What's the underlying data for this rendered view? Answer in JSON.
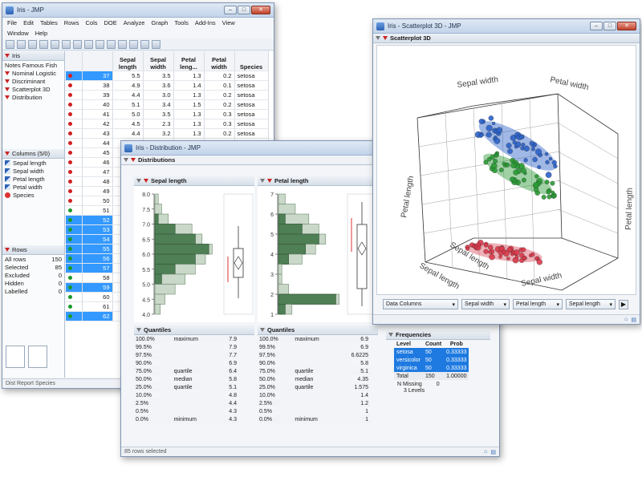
{
  "iris_window": {
    "title": "Iris - JMP",
    "menu": [
      "File",
      "Edit",
      "Tables",
      "Rows",
      "Cols",
      "DOE",
      "Analyze",
      "Graph",
      "Tools",
      "Add-Ins",
      "View"
    ],
    "menu2": [
      "Window",
      "Help"
    ],
    "table_panel": {
      "name": "Iris",
      "notes": "Notes",
      "notes_value": "Famous Fish",
      "scripts": [
        "Nominal Logistic",
        "Discriminant",
        "Scatterplot 3D",
        "Distribution"
      ]
    },
    "columns_panel": {
      "header": "Columns (5/0)",
      "columns": [
        "Sepal length",
        "Sepal width",
        "Petal length",
        "Petal width",
        "Species"
      ]
    },
    "rows_panel": {
      "header": "Rows",
      "items": [
        {
          "label": "All rows",
          "value": "150"
        },
        {
          "label": "Selected",
          "value": "85"
        },
        {
          "label": "Excluded",
          "value": "0"
        },
        {
          "label": "Hidden",
          "value": "0"
        },
        {
          "label": "Labelled",
          "value": "0"
        }
      ]
    },
    "col_headers": [
      "Sepal length",
      "Sepal width",
      "Petal leng...",
      "Petal width",
      "Species"
    ],
    "rows": [
      {
        "n": "37",
        "sl": "5.5",
        "sw": "3.5",
        "pl": "1.3",
        "pw": "0.2",
        "sp": "setosa",
        "sel": true,
        "color": "#d02020"
      },
      {
        "n": "38",
        "sl": "4.9",
        "sw": "3.6",
        "pl": "1.4",
        "pw": "0.1",
        "sp": "setosa",
        "sel": false,
        "color": "#d02020"
      },
      {
        "n": "39",
        "sl": "4.4",
        "sw": "3.0",
        "pl": "1.3",
        "pw": "0.2",
        "sp": "setosa",
        "sel": false,
        "color": "#d02020"
      },
      {
        "n": "40",
        "sl": "5.1",
        "sw": "3.4",
        "pl": "1.5",
        "pw": "0.2",
        "sp": "setosa",
        "sel": false,
        "color": "#d02020"
      },
      {
        "n": "41",
        "sl": "5.0",
        "sw": "3.5",
        "pl": "1.3",
        "pw": "0.3",
        "sp": "setosa",
        "sel": false,
        "color": "#d02020"
      },
      {
        "n": "42",
        "sl": "4.5",
        "sw": "2.3",
        "pl": "1.3",
        "pw": "0.3",
        "sp": "setosa",
        "sel": false,
        "color": "#d02020"
      },
      {
        "n": "43",
        "sl": "4.4",
        "sw": "3.2",
        "pl": "1.3",
        "pw": "0.2",
        "sp": "setosa",
        "sel": false,
        "color": "#d02020"
      },
      {
        "n": "44",
        "sl": "",
        "sw": "",
        "pl": "",
        "pw": "",
        "sp": "",
        "sel": false,
        "color": "#d02020"
      },
      {
        "n": "45",
        "sl": "",
        "sw": "",
        "pl": "",
        "pw": "",
        "sp": "",
        "sel": false,
        "color": "#d02020"
      },
      {
        "n": "46",
        "sl": "",
        "sw": "",
        "pl": "",
        "pw": "",
        "sp": "",
        "sel": false,
        "color": "#d02020"
      },
      {
        "n": "47",
        "sl": "",
        "sw": "",
        "pl": "",
        "pw": "",
        "sp": "",
        "sel": false,
        "color": "#d02020"
      },
      {
        "n": "48",
        "sl": "",
        "sw": "",
        "pl": "",
        "pw": "",
        "sp": "",
        "sel": false,
        "color": "#d02020"
      },
      {
        "n": "49",
        "sl": "",
        "sw": "",
        "pl": "",
        "pw": "",
        "sp": "",
        "sel": false,
        "color": "#d02020"
      },
      {
        "n": "50",
        "sl": "",
        "sw": "",
        "pl": "",
        "pw": "",
        "sp": "",
        "sel": false,
        "color": "#d02020"
      },
      {
        "n": "51",
        "sl": "",
        "sw": "",
        "pl": "",
        "pw": "",
        "sp": "",
        "sel": false,
        "color": "#1a9a2a"
      },
      {
        "n": "52",
        "sl": "",
        "sw": "",
        "pl": "",
        "pw": "",
        "sp": "",
        "sel": true,
        "color": "#1a9a2a"
      },
      {
        "n": "53",
        "sl": "",
        "sw": "",
        "pl": "",
        "pw": "",
        "sp": "",
        "sel": true,
        "color": "#1a9a2a"
      },
      {
        "n": "54",
        "sl": "",
        "sw": "",
        "pl": "",
        "pw": "",
        "sp": "",
        "sel": true,
        "color": "#1a9a2a"
      },
      {
        "n": "55",
        "sl": "",
        "sw": "",
        "pl": "",
        "pw": "",
        "sp": "",
        "sel": true,
        "color": "#1a9a2a"
      },
      {
        "n": "56",
        "sl": "",
        "sw": "",
        "pl": "",
        "pw": "",
        "sp": "",
        "sel": true,
        "color": "#1a9a2a"
      },
      {
        "n": "57",
        "sl": "",
        "sw": "",
        "pl": "",
        "pw": "",
        "sp": "",
        "sel": true,
        "color": "#1a9a2a"
      },
      {
        "n": "58",
        "sl": "",
        "sw": "",
        "pl": "",
        "pw": "",
        "sp": "",
        "sel": false,
        "color": "#1a9a2a"
      },
      {
        "n": "59",
        "sl": "",
        "sw": "",
        "pl": "",
        "pw": "",
        "sp": "",
        "sel": true,
        "color": "#1a9a2a"
      },
      {
        "n": "60",
        "sl": "",
        "sw": "",
        "pl": "",
        "pw": "",
        "sp": "",
        "sel": false,
        "color": "#1a9a2a"
      },
      {
        "n": "61",
        "sl": "",
        "sw": "",
        "pl": "",
        "pw": "",
        "sp": "",
        "sel": false,
        "color": "#1a9a2a"
      },
      {
        "n": "62",
        "sl": "",
        "sw": "",
        "pl": "",
        "pw": "",
        "sp": "",
        "sel": true,
        "color": "#1a9a2a"
      }
    ],
    "status": "Dist Report Species"
  },
  "dist_window": {
    "title": "Iris - Distribution - JMP",
    "header": "Distributions",
    "status": "85 rows selected",
    "panels": [
      {
        "name": "Sepal length",
        "ticks": [
          "8.0",
          "7.5",
          "7.0",
          "6.5",
          "6.0",
          "5.5",
          "5.0",
          "4.5",
          "4.0"
        ],
        "tick_range": [
          4.0,
          8.0
        ],
        "quantiles_title": "Quantiles",
        "quantiles": [
          {
            "p": "100.0%",
            "label": "maximum",
            "v": "7.9"
          },
          {
            "p": "99.5%",
            "label": "",
            "v": "7.9"
          },
          {
            "p": "97.5%",
            "label": "",
            "v": "7.7"
          },
          {
            "p": "90.0%",
            "label": "",
            "v": "6.9"
          },
          {
            "p": "75.0%",
            "label": "quartile",
            "v": "6.4"
          },
          {
            "p": "50.0%",
            "label": "median",
            "v": "5.8"
          },
          {
            "p": "25.0%",
            "label": "quartile",
            "v": "5.1"
          },
          {
            "p": "10.0%",
            "label": "",
            "v": "4.8"
          },
          {
            "p": "2.5%",
            "label": "",
            "v": "4.4"
          },
          {
            "p": "0.5%",
            "label": "",
            "v": "4.3"
          },
          {
            "p": "0.0%",
            "label": "minimum",
            "v": "4.3"
          }
        ]
      },
      {
        "name": "Petal length",
        "ticks": [
          "7",
          "6",
          "5",
          "4",
          "3",
          "2",
          "1"
        ],
        "tick_range": [
          1,
          7
        ],
        "quantiles_title": "Quantiles",
        "quantiles": [
          {
            "p": "100.0%",
            "label": "maximum",
            "v": "6.9"
          },
          {
            "p": "99.5%",
            "label": "",
            "v": "6.9"
          },
          {
            "p": "97.5%",
            "label": "",
            "v": "6.6225"
          },
          {
            "p": "90.0%",
            "label": "",
            "v": "5.8"
          },
          {
            "p": "75.0%",
            "label": "quartile",
            "v": "5.1"
          },
          {
            "p": "50.0%",
            "label": "median",
            "v": "4.35"
          },
          {
            "p": "25.0%",
            "label": "quartile",
            "v": "1.575"
          },
          {
            "p": "10.0%",
            "label": "",
            "v": "1.4"
          },
          {
            "p": "2.5%",
            "label": "",
            "v": "1.2"
          },
          {
            "p": "0.5%",
            "label": "",
            "v": "1"
          },
          {
            "p": "0.0%",
            "label": "minimum",
            "v": "1"
          }
        ]
      }
    ],
    "frequencies": {
      "title": "Frequencies",
      "headers": [
        "Level",
        "Count",
        "Prob"
      ],
      "rows": [
        {
          "level": "setosa",
          "count": "50",
          "prob": "0.33333"
        },
        {
          "level": "versicolor",
          "count": "50",
          "prob": "0.33333"
        },
        {
          "level": "virginica",
          "count": "50",
          "prob": "0.33333"
        }
      ],
      "total": {
        "level": "Total",
        "count": "150",
        "prob": "1.00000"
      },
      "missing_label": "N Missing",
      "missing_value": "0",
      "levels_text": "3",
      "levels_label": "Levels"
    }
  },
  "scatter_window": {
    "title": "Iris - Scatterplot 3D - JMP",
    "header": "Scatterplot 3D",
    "axis_labels": {
      "top_left": "Sepal width",
      "top_right": "Petal width",
      "left": "Petal length",
      "right": "Petal length",
      "bottom_left": "Sepal length",
      "bottom_left2": "Sepal length",
      "bottom_right": "Sepal width"
    },
    "controls": [
      "Data Columns",
      "Sepal width",
      "Petal length",
      "Sepal length"
    ],
    "colors": {
      "setosa": "#d83a4a",
      "versicolor": "#2a9a35",
      "virginica": "#2d62c8"
    }
  }
}
